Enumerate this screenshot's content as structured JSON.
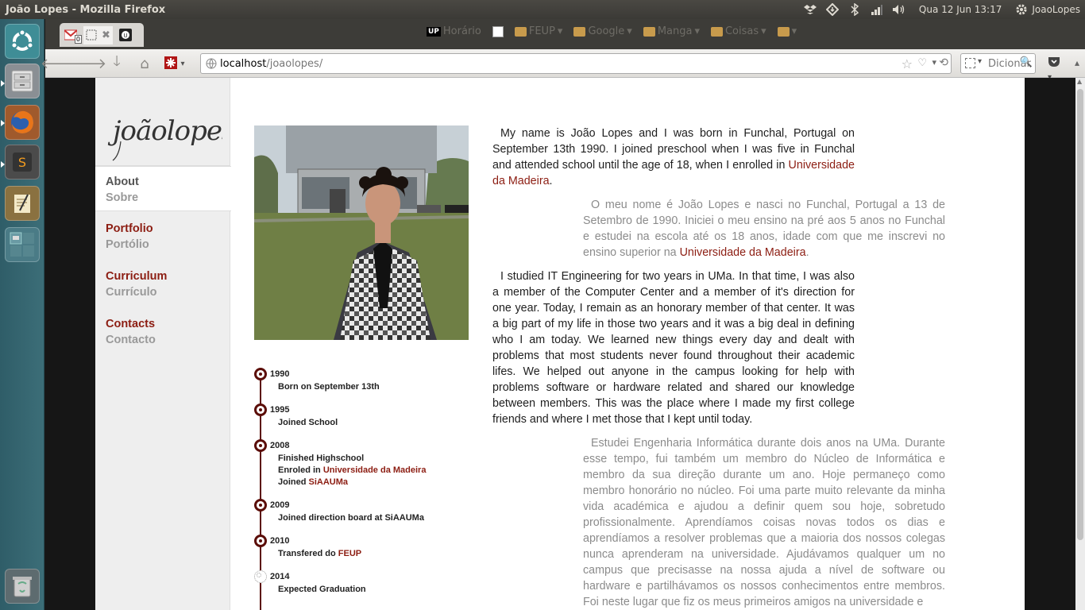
{
  "window": {
    "title": "João Lopes - Mozilla Firefox",
    "clock": "Qua 12 Jun  13:17",
    "user": "JoaoLopes"
  },
  "tabs": [
    {
      "icon": "gmail-icon",
      "badge": "0"
    },
    {
      "icon": "blank-page-icon",
      "active": true
    },
    {
      "icon": "up-icon"
    }
  ],
  "bookmarks": [
    {
      "label": "Horário",
      "icon": "up-icon"
    },
    {
      "label": "",
      "icon": "feup-icon"
    },
    {
      "label": "FEUP",
      "icon": "folder-icon"
    },
    {
      "label": "Google",
      "icon": "folder-icon"
    },
    {
      "label": "Manga",
      "icon": "folder-icon"
    },
    {
      "label": "Coisas",
      "icon": "folder-icon"
    },
    {
      "label": "",
      "icon": "folder-icon"
    }
  ],
  "nav": {
    "url_host": "localhost",
    "url_path": "/joaolopes/",
    "search_placeholder": "Dicionár"
  },
  "site": {
    "logo_text": "joãolopes",
    "menu": [
      {
        "en": "About",
        "pt": "Sobre"
      },
      {
        "en": "Portfolio",
        "pt": "Portólio"
      },
      {
        "en": "Curriculum",
        "pt": "Currículo"
      },
      {
        "en": "Contacts",
        "pt": "Contacto"
      }
    ],
    "timeline": [
      {
        "year": "1990",
        "lines": [
          [
            "Born on September 13th",
            ""
          ]
        ]
      },
      {
        "year": "1995",
        "lines": [
          [
            "Joined School",
            ""
          ]
        ]
      },
      {
        "year": "2008",
        "lines": [
          [
            "Finished Highschool",
            ""
          ],
          [
            "Enroled in ",
            "Universidade da Madeira"
          ],
          [
            "Joined ",
            "SiAAUMa"
          ]
        ]
      },
      {
        "year": "2009",
        "lines": [
          [
            "Joined direction board at SiAAUMa",
            ""
          ]
        ]
      },
      {
        "year": "2010",
        "lines": [
          [
            "Transfered do ",
            "FEUP"
          ]
        ]
      },
      {
        "year": "2014",
        "lines": [
          [
            "Expected Graduation",
            ""
          ]
        ]
      }
    ],
    "bio_en_1a": "My name is João Lopes and I was born in Funchal, Portugal on September 13th 1990. I joined preschool when I was five in Funchal and attended school until the age of 18, when I enrolled in ",
    "bio_en_1_link": "Universidade da Madeira",
    "bio_pt_1a": "O meu nome é João Lopes e nasci no Funchal, Portugal a 13 de Setembro de 1990. Iniciei o meu ensino na pré aos 5 anos no Funchal e estudei na escola até os 18 anos, idade com que me inscrevi no ensino superior na ",
    "bio_pt_1_link": "Universidade da Madeira",
    "bio_en_2": "I studied IT Engineering for two years in UMa. In that time, I was also a member of the Computer Center and a member of it's direction for one year. Today, I remain as an honorary member of that center. It was a big part of my life in those two years and it was a big deal in defining who I am today. We learned new things every day and dealt with problems that most students never found throughout their academic lifes. We helped out anyone in the campus looking for help with problems software or hardware related and shared our knowledge between members. This was the place where I made my first college friends and where I met those that I kept until today.",
    "bio_pt_2": "Estudei Engenharia Informática durante dois anos na UMa. Durante esse tempo, fui também um membro do Núcleo de Informática e membro da sua direção durante um ano. Hoje permaneço como membro honorário no núcleo. Foi uma parte muito relevante da minha vida académica e ajudou a definir quem sou hoje, sobretudo profissionalmente. Aprendíamos coisas novas todos os dias e aprendíamos a resolver problemas que a maioria dos nossos colegas nunca aprenderam na universidade. Ajudávamos qualquer um no campus que precisasse na nossa ajuda a nível de software ou hardware e partilhávamos os nossos conhecimentos entre membros. Foi neste lugar que fiz os meus primeiros amigos na universidade e"
  }
}
